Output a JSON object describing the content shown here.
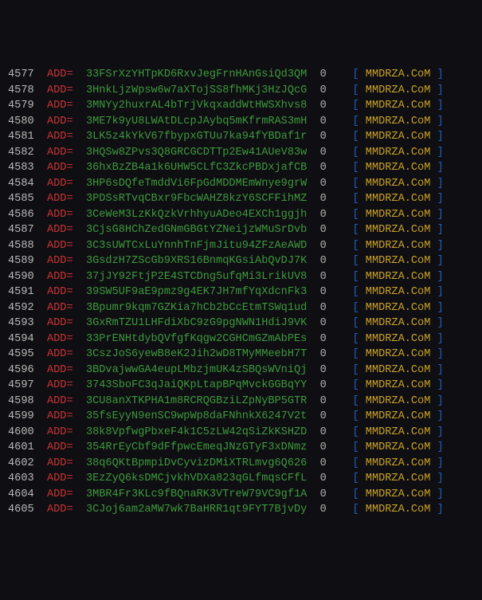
{
  "key_label": "ADD=",
  "open_bracket": "[",
  "close_bracket": "]",
  "source": "MMDRZA.CoM",
  "rows": [
    {
      "idx": "4577",
      "addr": "33FSrXzYHTpKD6RxvJegFrnHAnGsiQd3QM",
      "cnt": "0"
    },
    {
      "idx": "4578",
      "addr": "3HnkLjzWpsw6w7aXTojSS8fhMKj3HzJQcG",
      "cnt": "0"
    },
    {
      "idx": "4579",
      "addr": "3MNYy2huxrAL4bTrjVkqxaddWtHWSXhvs8",
      "cnt": "0"
    },
    {
      "idx": "4580",
      "addr": "3ME7k9yU8LWAtDLcpJAybq5mKfrmRAS3mH",
      "cnt": "0"
    },
    {
      "idx": "4581",
      "addr": "3LK5z4kYkV67fbypxGTUu7ka94fYBDaf1r",
      "cnt": "0"
    },
    {
      "idx": "4582",
      "addr": "3HQSw8ZPvs3Q8GRCGCDTTp2Ew41AUeV83w",
      "cnt": "0"
    },
    {
      "idx": "4583",
      "addr": "36hxBzZB4a1k6UHW5CLfC3ZkcPBDxjafCB",
      "cnt": "0"
    },
    {
      "idx": "4584",
      "addr": "3HP6sDQfeTmddVi6FpGdMDDMEmWnye9grW",
      "cnt": "0"
    },
    {
      "idx": "4585",
      "addr": "3PDSsRTvqCBxr9FbcWAHZ8kzY6SCFFihMZ",
      "cnt": "0"
    },
    {
      "idx": "4586",
      "addr": "3CeWeM3LzKkQzkVrhhyuADeo4EXCh1ggjh",
      "cnt": "0"
    },
    {
      "idx": "4587",
      "addr": "3CjsG8HChZedGNmGBGtYZNeijzWMuSrDvb",
      "cnt": "0"
    },
    {
      "idx": "4588",
      "addr": "3C3sUWTCxLuYnnhTnFjmJitu94ZFzAeAWD",
      "cnt": "0"
    },
    {
      "idx": "4589",
      "addr": "3GsdzH7ZScGb9XRS16BnmqKGsiAbQvDJ7K",
      "cnt": "0"
    },
    {
      "idx": "4590",
      "addr": "37jJY92FtjP2E4STCDng5ufqMi3LrikUV8",
      "cnt": "0"
    },
    {
      "idx": "4591",
      "addr": "39SW5UF9aE9pmz9g4EK7JH7mfYqXdcnFk3",
      "cnt": "0"
    },
    {
      "idx": "4592",
      "addr": "3Bpumr9kqm7GZKia7hCb2bCcEtmTSWq1ud",
      "cnt": "0"
    },
    {
      "idx": "4593",
      "addr": "3GxRmTZU1LHFdiXbC9zG9pgNWN1HdiJ9VK",
      "cnt": "0"
    },
    {
      "idx": "4594",
      "addr": "33PrENHtdybQVfgfKqgw2CGHCmGZmAbPEs",
      "cnt": "0"
    },
    {
      "idx": "4595",
      "addr": "3CszJoS6yewB8eK2Jih2wD8TMyMMeebH7T",
      "cnt": "0"
    },
    {
      "idx": "4596",
      "addr": "3BDvajwwGA4eupLMbzjmUK4zSBQsWVniQj",
      "cnt": "0"
    },
    {
      "idx": "4597",
      "addr": "3743SboFC3qJaiQKpLtapBPqMvckGGBqYY",
      "cnt": "0"
    },
    {
      "idx": "4598",
      "addr": "3CU8anXTKPHA1m8RCRQGBziLZpNyBP5GTR",
      "cnt": "0"
    },
    {
      "idx": "4599",
      "addr": "35fsEyyN9enSC9wpWp8daFNhnkX6247V2t",
      "cnt": "0"
    },
    {
      "idx": "4600",
      "addr": "38k8VpfwgPbxeF4k1C5zLW42qSiZkKSHZD",
      "cnt": "0"
    },
    {
      "idx": "4601",
      "addr": "354RrEyCbf9dFfpwcEmeqJNzGTyF3xDNmz",
      "cnt": "0"
    },
    {
      "idx": "4602",
      "addr": "38q6QKtBpmpiDvCyvizDMiXTRLmvg6Q626",
      "cnt": "0"
    },
    {
      "idx": "4603",
      "addr": "3EzZyQ6ksDMCjvkhVDXa823qGLfmqsCFfL",
      "cnt": "0"
    },
    {
      "idx": "4604",
      "addr": "3MBR4Fr3KLc9fBQnaRK3VTreW79VC9gf1A",
      "cnt": "0"
    },
    {
      "idx": "4605",
      "addr": "3CJoj6am2aMW7wk7BaHRR1qt9FYT7BjvDy",
      "cnt": "0"
    }
  ]
}
